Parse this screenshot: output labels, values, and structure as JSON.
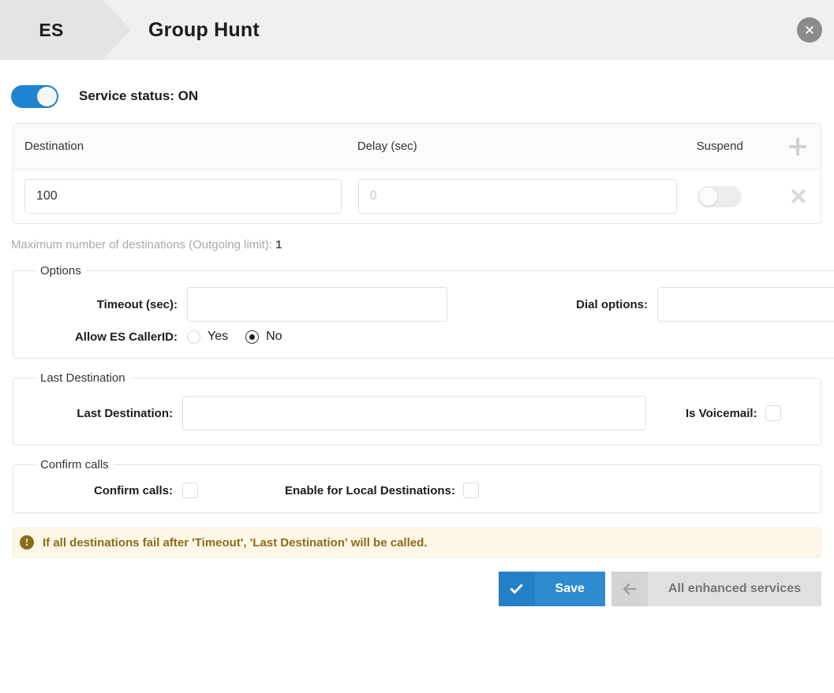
{
  "header": {
    "breadcrumb_service": "ES",
    "title": "Group Hunt",
    "close_icon": "close-circle-icon"
  },
  "service": {
    "toggle_state": "on",
    "status_label": "Service status: ON"
  },
  "destinations_table": {
    "columns": {
      "destination": "Destination",
      "delay": "Delay (sec)",
      "suspend": "Suspend"
    },
    "add_icon": "plus-icon",
    "rows": [
      {
        "destination_value": "100",
        "delay_value": "",
        "delay_placeholder": "0",
        "suspend_state": "off",
        "remove_icon": "close-x-icon"
      }
    ],
    "max_note_text": "Maximum number of destinations (Outgoing limit):",
    "max_note_value": "1"
  },
  "options": {
    "legend": "Options",
    "timeout_label": "Timeout (sec):",
    "timeout_value": "",
    "dial_options_label": "Dial options:",
    "dial_options_value": "",
    "caller_id_label": "Allow ES CallerID:",
    "caller_id_yes": "Yes",
    "caller_id_no": "No",
    "caller_id_selected": "No"
  },
  "last_destination": {
    "legend": "Last Destination",
    "field_label": "Last Destination:",
    "field_value": "",
    "is_voicemail_label": "Is Voicemail:",
    "is_voicemail_checked": false
  },
  "confirm_calls": {
    "legend": "Confirm calls",
    "confirm_label": "Confirm calls:",
    "confirm_checked": false,
    "local_label": "Enable for Local Destinations:",
    "local_checked": false
  },
  "warning": {
    "icon": "exclamation-circle-icon",
    "text": "If all destinations fail after 'Timeout', 'Last Destination' will be called.",
    "color": "#8a6d1a",
    "background": "#fdf7e8"
  },
  "footer": {
    "save_label": "Save",
    "save_icon": "check-icon",
    "save_color": "#2e8bd0",
    "back_label": "All enhanced services",
    "back_icon": "arrow-left-icon",
    "back_color": "#e0e0e0"
  }
}
